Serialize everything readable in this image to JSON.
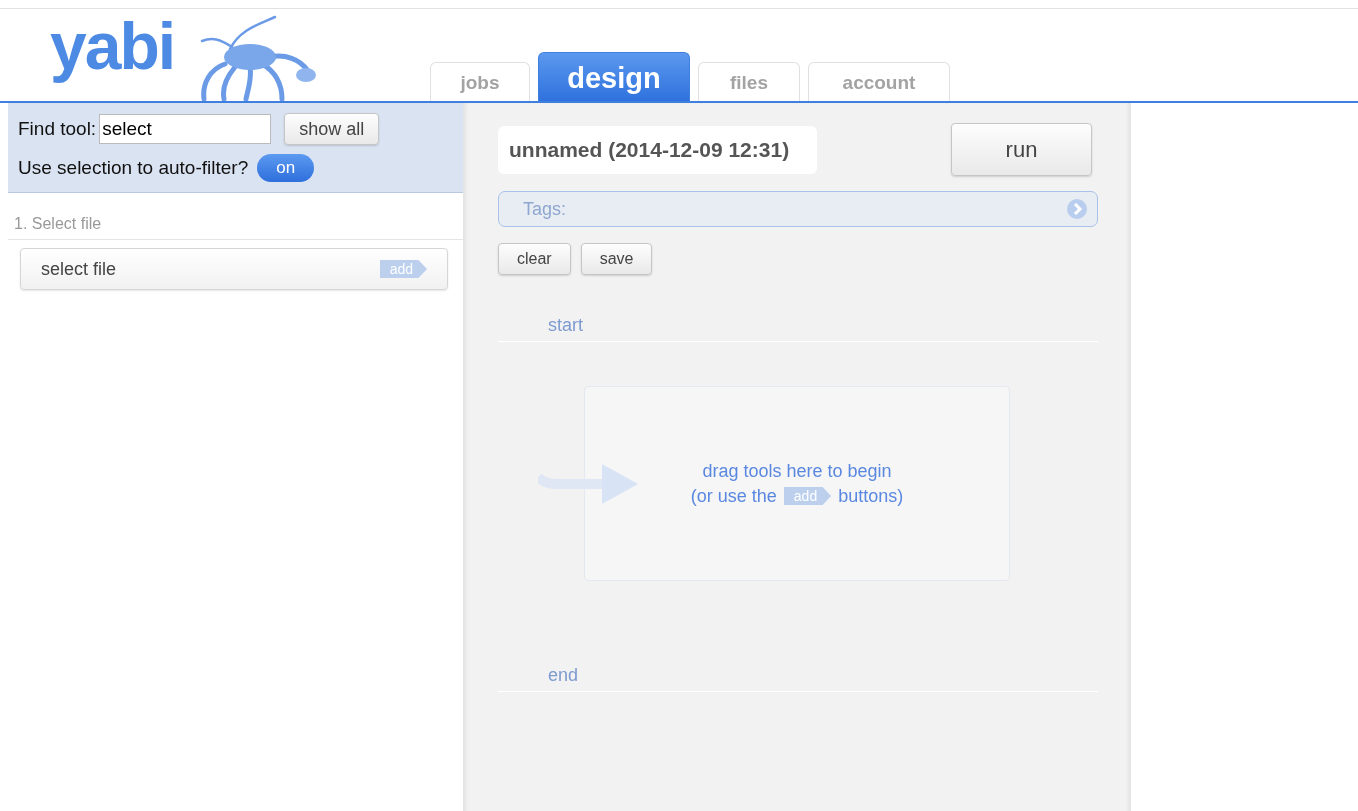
{
  "logo": {
    "text": "yabi"
  },
  "tabs": [
    {
      "label": "jobs",
      "selected": false
    },
    {
      "label": "design",
      "selected": true
    },
    {
      "label": "files",
      "selected": false
    },
    {
      "label": "account",
      "selected": false
    }
  ],
  "tool_finder": {
    "label": "Find tool:",
    "value": "select",
    "show_all_button": "show all",
    "auto_filter_label": "Use selection to auto-filter?",
    "auto_filter_toggle": "on",
    "auto_filter_on": true
  },
  "tool_groups": [
    {
      "title": "1. Select file",
      "tools": [
        {
          "name": "select file",
          "add_label": "add"
        }
      ]
    }
  ],
  "workflow": {
    "name": "unnamed (2014-12-09 12:31)",
    "run_button": "run",
    "tags_placeholder": "Tags:",
    "buttons": [
      "clear",
      "save"
    ],
    "start_label": "start",
    "end_label": "end",
    "drop_hint": {
      "line_1": "drag tools here to begin",
      "line_2_before": "(or use the",
      "line_2_badge": "add",
      "line_2_after": "buttons)"
    }
  }
}
